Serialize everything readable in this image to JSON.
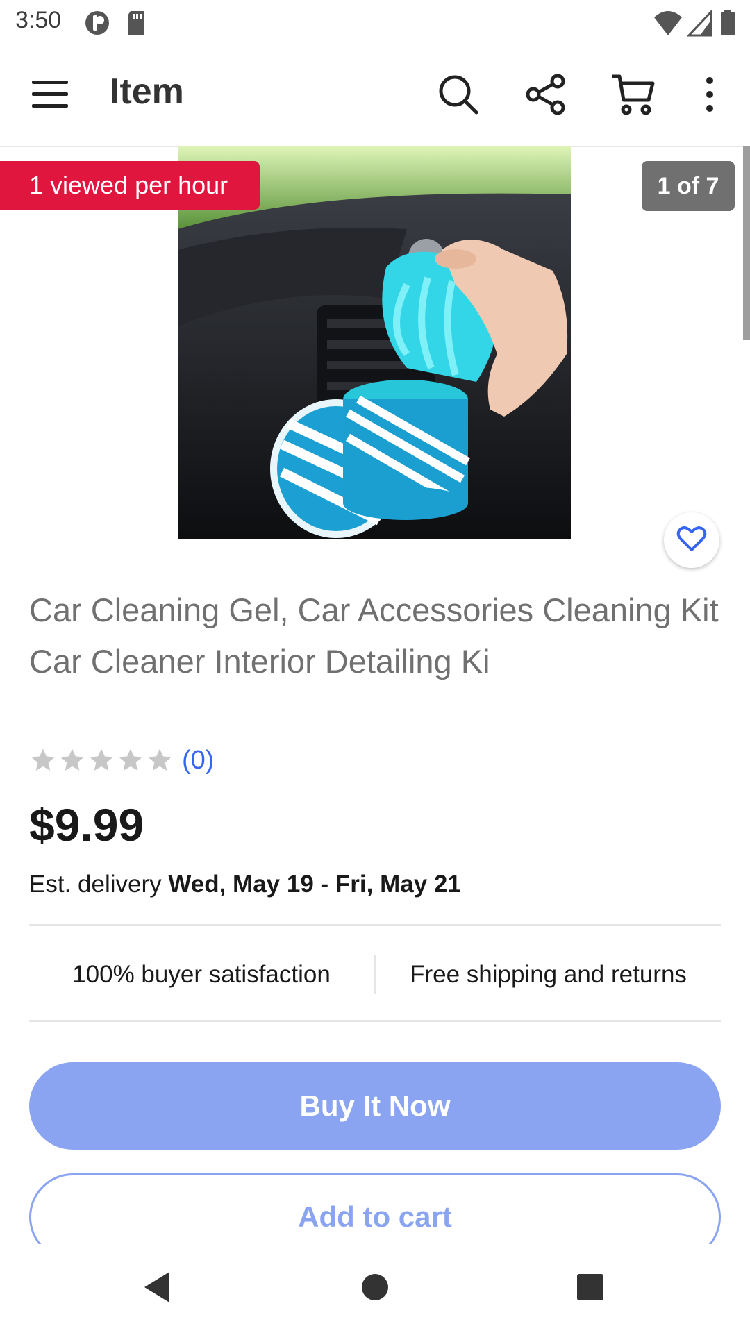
{
  "status_bar": {
    "time": "3:50",
    "icons": [
      "notification-app-icon",
      "sd-card-icon",
      "wifi-icon",
      "signal-icon",
      "battery-icon"
    ]
  },
  "app_bar": {
    "title": "Item",
    "icons": [
      "menu-icon",
      "search-icon",
      "share-icon",
      "cart-icon",
      "more-vertical-icon"
    ]
  },
  "gallery": {
    "views_badge": "1 viewed per hour",
    "counter": "1 of 7",
    "badge_color": "#e0163f",
    "watch_icon": "heart-icon"
  },
  "product": {
    "title": "Car Cleaning Gel, Car Accessories Cleaning Kit Car Cleaner Interior Detailing Ki",
    "rating_stars": 0,
    "review_count": "(0)",
    "price": "$9.99",
    "delivery_prefix": "Est. delivery ",
    "delivery_dates": "Wed, May 19 - Fri, May 21"
  },
  "features": {
    "satisfaction": "100% buyer satisfaction",
    "shipping": "Free shipping and returns"
  },
  "actions": {
    "buy_now": "Buy It Now",
    "add_to_cart": "Add to cart",
    "accent_color": "#8aa4f2"
  },
  "nav_bar": {
    "icons": [
      "back-icon",
      "home-icon",
      "recents-icon"
    ]
  }
}
